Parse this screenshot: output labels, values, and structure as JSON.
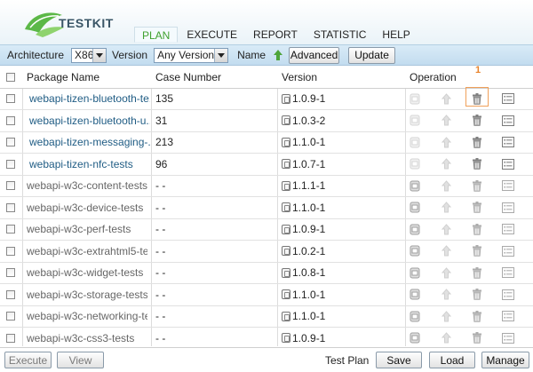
{
  "app": {
    "logo_text": "TESTKIT"
  },
  "nav": [
    {
      "label": "PLAN",
      "active": true
    },
    {
      "label": "EXECUTE",
      "active": false
    },
    {
      "label": "REPORT",
      "active": false
    },
    {
      "label": "STATISTIC",
      "active": false
    },
    {
      "label": "HELP",
      "active": false
    }
  ],
  "toolbar": {
    "architecture_label": "Architecture",
    "architecture_value": "X86",
    "version_label": "Version",
    "version_value": "Any Version",
    "name_label": "Name",
    "advanced_label": "Advanced",
    "update_label": "Update"
  },
  "table": {
    "headers": {
      "package": "Package Name",
      "case": "Case Number",
      "version": "Version",
      "operation": "Operation"
    },
    "rows": [
      {
        "name": "webapi-tizen-bluetooth-te...",
        "cases": "135",
        "version": "1.0.9-1",
        "installed": true
      },
      {
        "name": "webapi-tizen-bluetooth-u...",
        "cases": "31",
        "version": "1.0.3-2",
        "installed": true
      },
      {
        "name": "webapi-tizen-messaging-...",
        "cases": "213",
        "version": "1.1.0-1",
        "installed": true
      },
      {
        "name": "webapi-tizen-nfc-tests",
        "cases": "96",
        "version": "1.0.7-1",
        "installed": true
      },
      {
        "name": "webapi-w3c-content-tests",
        "cases": "- -",
        "version": "1.1.1-1",
        "installed": false
      },
      {
        "name": "webapi-w3c-device-tests",
        "cases": "- -",
        "version": "1.1.0-1",
        "installed": false
      },
      {
        "name": "webapi-w3c-perf-tests",
        "cases": "- -",
        "version": "1.0.9-1",
        "installed": false
      },
      {
        "name": "webapi-w3c-extrahtml5-te...",
        "cases": "- -",
        "version": "1.0.2-1",
        "installed": false
      },
      {
        "name": "webapi-w3c-widget-tests",
        "cases": "- -",
        "version": "1.0.8-1",
        "installed": false
      },
      {
        "name": "webapi-w3c-storage-tests",
        "cases": "- -",
        "version": "1.1.0-1",
        "installed": false
      },
      {
        "name": "webapi-w3c-networking-te...",
        "cases": "- -",
        "version": "1.1.0-1",
        "installed": false
      },
      {
        "name": "webapi-w3c-css3-tests",
        "cases": "- -",
        "version": "1.0.9-1",
        "installed": false
      }
    ]
  },
  "annotation": {
    "number": "1"
  },
  "bottom": {
    "execute_label": "Execute",
    "view_label": "View",
    "test_plan_label": "Test Plan",
    "save_label": "Save",
    "load_label": "Load",
    "manage_label": "Manage"
  },
  "colors": {
    "accent": "#3fa12f",
    "link": "#1f5c84",
    "highlight": "#f0a05a",
    "toolbar": "#cfe3f2"
  },
  "icons": [
    "logo-leaf-icon",
    "name-sort-icon",
    "package-icon",
    "upgrade-arrow-icon",
    "uninstall-trash-icon",
    "detail-list-icon",
    "version-icon"
  ]
}
